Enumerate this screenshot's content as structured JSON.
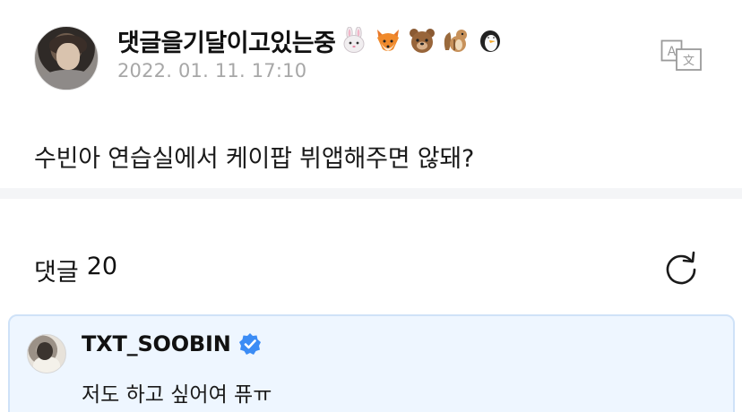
{
  "post": {
    "author_name": "댓글을기달이고있는중",
    "author_emojis": [
      "rabbit-emoji",
      "fox-emoji",
      "bear-emoji",
      "chipmunk-emoji",
      "penguin-emoji"
    ],
    "timestamp": "2022. 01. 11. 17:10",
    "translate_icon": "translate-icon",
    "body": "수빈아 연습실에서 케이팝 뷔앱해주면 않돼?"
  },
  "comments": {
    "label": "댓글",
    "count": "20",
    "refresh_icon": "refresh-icon"
  },
  "reply": {
    "author_name": "TXT_SOOBIN",
    "verified_icon": "verified-badge-icon",
    "text": "저도 하고 싶어여 퓨ㅠ"
  },
  "colors": {
    "timestamp": "#a7a7a7",
    "divider": "#f4f5f7",
    "reply_bg": "#eef6ff",
    "reply_border": "#cfe2f8",
    "verified": "#3b8cf5"
  }
}
